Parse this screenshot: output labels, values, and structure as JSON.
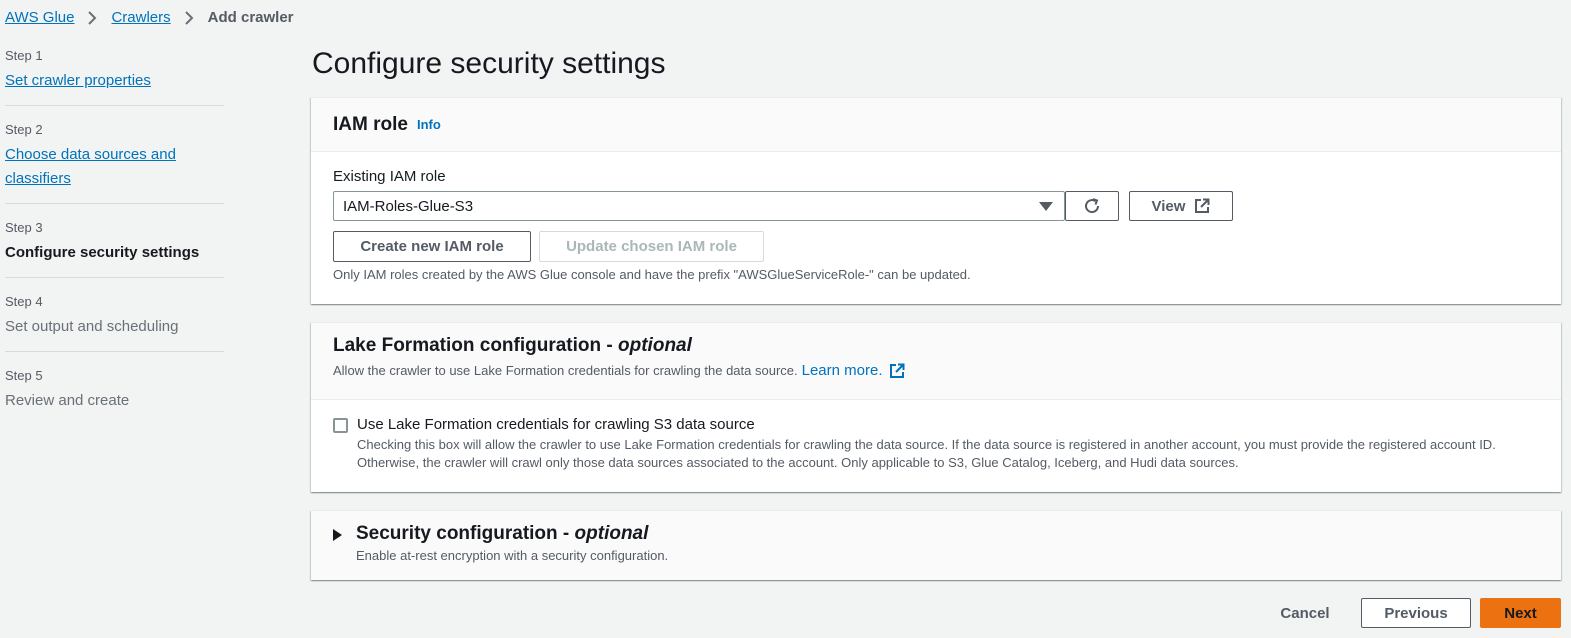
{
  "breadcrumb": {
    "items": [
      "AWS Glue",
      "Crawlers"
    ],
    "current": "Add crawler"
  },
  "steps": [
    {
      "num": "Step 1",
      "title": "Set crawler properties"
    },
    {
      "num": "Step 2",
      "title": "Choose data sources and classifiers"
    },
    {
      "num": "Step 3",
      "title": "Configure security settings"
    },
    {
      "num": "Step 4",
      "title": "Set output and scheduling"
    },
    {
      "num": "Step 5",
      "title": "Review and create"
    }
  ],
  "page_title": "Configure security settings",
  "iam": {
    "title": "IAM role",
    "info": "Info",
    "field_label": "Existing IAM role",
    "selected_role": "IAM-Roles-Glue-S3",
    "view_label": "View",
    "create_label": "Create new IAM role",
    "update_label": "Update chosen IAM role",
    "hint": "Only IAM roles created by the AWS Glue console and have the prefix \"AWSGlueServiceRole-\" can be updated."
  },
  "lake": {
    "title": "Lake Formation configuration - ",
    "title_optional": "optional",
    "description": "Allow the crawler to use Lake Formation credentials for crawling the data source.",
    "learn_more": "Learn more.",
    "checkbox_label": "Use Lake Formation credentials for crawling S3 data source",
    "checkbox_desc": "Checking this box will allow the crawler to use Lake Formation credentials for crawling the data source. If the data source is registered in another account, you must provide the registered account ID. Otherwise, the crawler will crawl only those data sources associated to the account. Only applicable to S3, Glue Catalog, Iceberg, and Hudi data sources.",
    "checked": false
  },
  "security": {
    "title": "Security configuration - ",
    "title_optional": "optional",
    "description": "Enable at-rest encryption with a security configuration."
  },
  "footer": {
    "cancel": "Cancel",
    "previous": "Previous",
    "next": "Next"
  },
  "colors": {
    "link": "#0073bb",
    "primary": "#ec7211",
    "background": "#f2f3f3"
  }
}
